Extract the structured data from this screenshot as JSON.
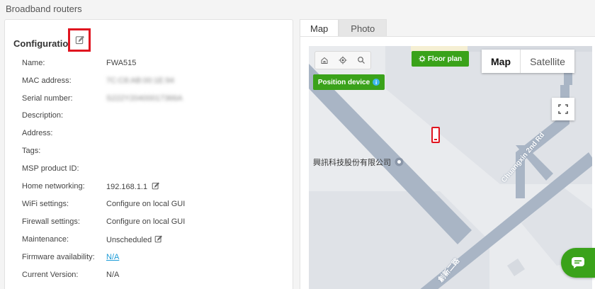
{
  "page": {
    "title": "Broadband routers"
  },
  "config": {
    "header": "Configuration",
    "fields": [
      {
        "label": "Name:",
        "value": "FWA515"
      },
      {
        "label": "MAC address:",
        "value": "7C:C8:AB:00:1E:94"
      },
      {
        "label": "Serial number:",
        "value": "S222Y20400017366A"
      },
      {
        "label": "Description:",
        "value": ""
      },
      {
        "label": "Address:",
        "value": ""
      },
      {
        "label": "Tags:",
        "value": ""
      },
      {
        "label": "MSP product ID:",
        "value": ""
      },
      {
        "label": "Home networking:",
        "value": "192.168.1.1"
      },
      {
        "label": "WiFi settings:",
        "value": "Configure on local GUI"
      },
      {
        "label": "Firewall settings:",
        "value": "Configure on local GUI"
      },
      {
        "label": "Maintenance:",
        "value": "Unscheduled"
      },
      {
        "label": "Firmware availability:",
        "value": "N/A"
      },
      {
        "label": "Current Version:",
        "value": "N/A"
      }
    ]
  },
  "tabs": {
    "map": "Map",
    "photo": "Photo"
  },
  "map": {
    "floor_plan": "Floor plan",
    "position_device": "Position device",
    "map_type_map": "Map",
    "map_type_satellite": "Satellite",
    "poi": "興訊科技股份有限公司",
    "road_chuangxin": "Chuangxin 2nd Rd",
    "road_chinese": "創新二路"
  },
  "colors": {
    "accent_green": "#3aa21a",
    "highlight_red": "#e0141f",
    "link_blue": "#1b9bd7"
  }
}
